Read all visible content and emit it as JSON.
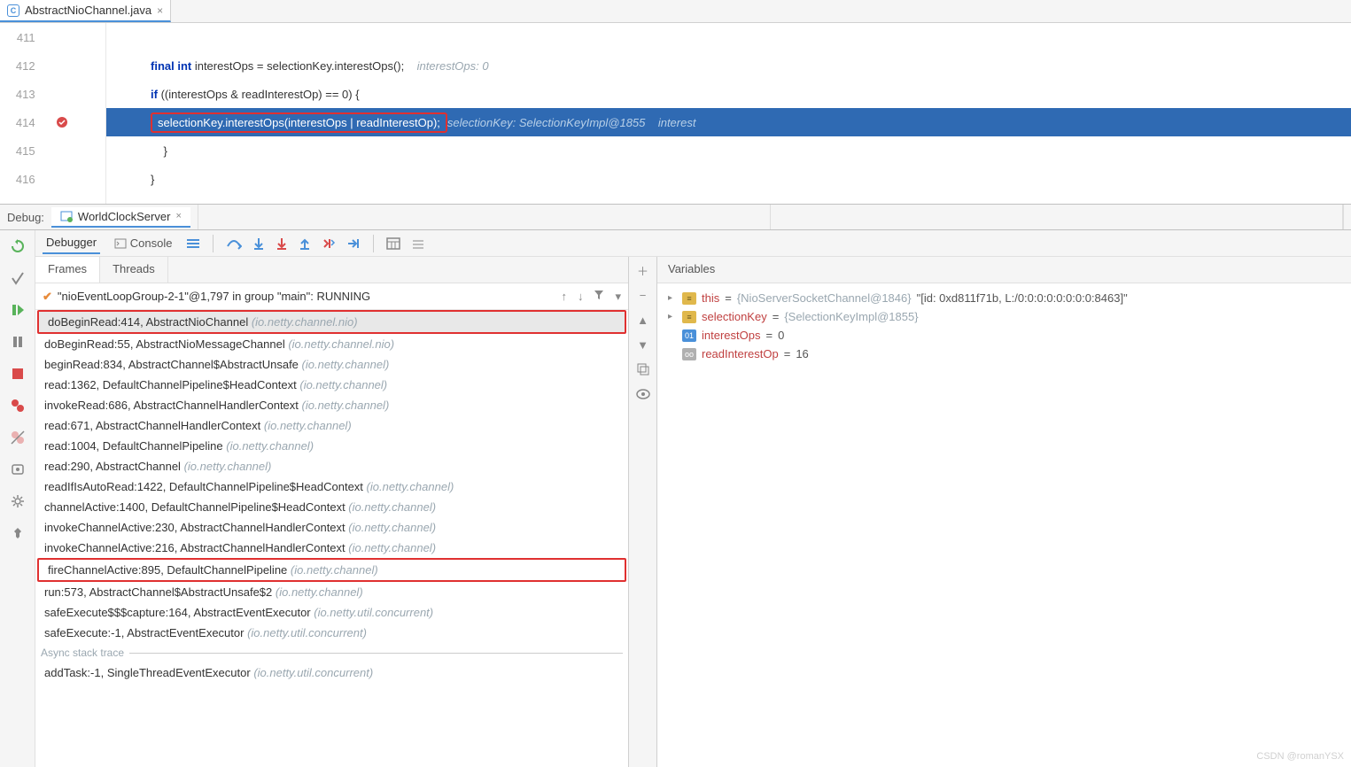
{
  "editor": {
    "filename": "AbstractNioChannel.java",
    "lines": [
      {
        "num": "411",
        "code": ""
      },
      {
        "num": "412",
        "code": "final int interestOps = selectionKey.interestOps();",
        "hint": "interestOps: 0"
      },
      {
        "num": "413",
        "code": "if ((interestOps & readInterestOp) == 0) {"
      },
      {
        "num": "414",
        "code": "selectionKey.interestOps(interestOps | readInterestOp);",
        "hint": "selectionKey: SelectionKeyImpl@1855    interest",
        "hl": true
      },
      {
        "num": "415",
        "code": "}"
      },
      {
        "num": "416",
        "code": "}"
      }
    ]
  },
  "debug": {
    "label": "Debug:",
    "config": "WorldClockServer",
    "tabs": {
      "debugger": "Debugger",
      "console": "Console"
    },
    "frames_tabs": {
      "frames": "Frames",
      "threads": "Threads"
    },
    "thread": "\"nioEventLoopGroup-2-1\"@1,797 in group \"main\": RUNNING",
    "frames": [
      {
        "m": "doBeginRead:414, AbstractNioChannel ",
        "p": "(io.netty.channel.nio)",
        "sel": true,
        "box": true
      },
      {
        "m": "doBeginRead:55, AbstractNioMessageChannel ",
        "p": "(io.netty.channel.nio)"
      },
      {
        "m": "beginRead:834, AbstractChannel$AbstractUnsafe ",
        "p": "(io.netty.channel)"
      },
      {
        "m": "read:1362, DefaultChannelPipeline$HeadContext ",
        "p": "(io.netty.channel)"
      },
      {
        "m": "invokeRead:686, AbstractChannelHandlerContext ",
        "p": "(io.netty.channel)"
      },
      {
        "m": "read:671, AbstractChannelHandlerContext ",
        "p": "(io.netty.channel)"
      },
      {
        "m": "read:1004, DefaultChannelPipeline ",
        "p": "(io.netty.channel)"
      },
      {
        "m": "read:290, AbstractChannel ",
        "p": "(io.netty.channel)"
      },
      {
        "m": "readIfIsAutoRead:1422, DefaultChannelPipeline$HeadContext ",
        "p": "(io.netty.channel)"
      },
      {
        "m": "channelActive:1400, DefaultChannelPipeline$HeadContext ",
        "p": "(io.netty.channel)"
      },
      {
        "m": "invokeChannelActive:230, AbstractChannelHandlerContext ",
        "p": "(io.netty.channel)"
      },
      {
        "m": "invokeChannelActive:216, AbstractChannelHandlerContext ",
        "p": "(io.netty.channel)"
      },
      {
        "m": "fireChannelActive:895, DefaultChannelPipeline ",
        "p": "(io.netty.channel)",
        "box": true
      },
      {
        "m": "run:573, AbstractChannel$AbstractUnsafe$2 ",
        "p": "(io.netty.channel)"
      },
      {
        "m": "safeExecute$$$capture:164, AbstractEventExecutor ",
        "p": "(io.netty.util.concurrent)"
      },
      {
        "m": "safeExecute:-1, AbstractEventExecutor ",
        "p": "(io.netty.util.concurrent)"
      }
    ],
    "async_label": "Async stack trace",
    "async_frames": [
      {
        "m": "addTask:-1, SingleThreadEventExecutor ",
        "p": "(io.netty.util.concurrent)"
      }
    ],
    "vars_label": "Variables",
    "vars": [
      {
        "kind": "obj",
        "arrow": true,
        "name": "this",
        "eq": " = ",
        "gray": "{NioServerSocketChannel@1846}",
        "val": " \"[id: 0xd811f71b, L:/0:0:0:0:0:0:0:0:8463]\""
      },
      {
        "kind": "obj",
        "arrow": true,
        "name": "selectionKey",
        "eq": " = ",
        "gray": "{SelectionKeyImpl@1855}",
        "val": ""
      },
      {
        "kind": "int",
        "arrow": false,
        "name": "interestOps",
        "eq": " = ",
        "gray": "",
        "val": "0",
        "badge": "01"
      },
      {
        "kind": "ro",
        "arrow": false,
        "name": "readInterestOp",
        "eq": " = ",
        "gray": "",
        "val": "16",
        "badge": "oo"
      }
    ]
  },
  "watermark": "CSDN @romanYSX"
}
